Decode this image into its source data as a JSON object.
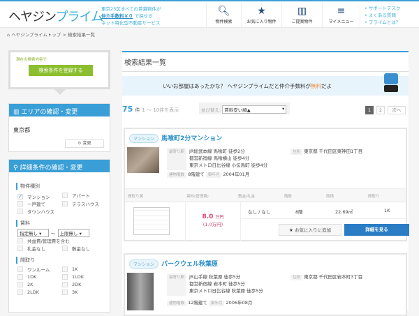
{
  "header": {
    "logo_a": "ヘヤジン",
    "logo_b": "プライム",
    "tagline1": "東京23区すべての賃貸物件が",
    "tagline2a": "仲介手数料￥０",
    "tagline2b": "で探せる",
    "tagline3": "ネット特化型不動産サービス",
    "nav": [
      {
        "icon": "search-icon",
        "glyph": "🔍︎",
        "label": "物件検索"
      },
      {
        "icon": "star-icon",
        "glyph": "★",
        "label": "お気に入り物件"
      },
      {
        "icon": "building-icon",
        "glyph": "▥",
        "label": "ご提案物件"
      },
      {
        "icon": "menu-icon",
        "glyph": "≡",
        "label": "マイメニュー"
      }
    ],
    "links": [
      "サポートデスク",
      "よくある質問",
      "プライムとは？"
    ]
  },
  "breadcrumb": {
    "home": "ヘヤジンプライムトップ",
    "sep": ">",
    "current": "検索結果一覧"
  },
  "sidebar": {
    "save_label": "現在の検索内容で",
    "save_button": "検索条件を登録する",
    "area_title": "エリアの確認・変更",
    "area_value": "東京都",
    "change_button": "変更",
    "detail_title": "詳細条件の確認・変更",
    "type_title": "物件種別",
    "types": [
      {
        "label": "マンション",
        "checked": true
      },
      {
        "label": "アパート",
        "checked": false
      },
      {
        "label": "一戸建て",
        "checked": false
      },
      {
        "label": "テラスハウス",
        "checked": false
      },
      {
        "label": "タウンハウス",
        "checked": false
      }
    ],
    "rent_title": "賃料",
    "rent_min": "指定無し",
    "rent_tilde": "～",
    "rent_max": "上限無し",
    "rent_opts": [
      "共益費/管理費を含む",
      "礼金なし",
      "敷金なし"
    ],
    "layout_title": "間取り",
    "layouts": [
      "ワンルーム",
      "1K",
      "1DK",
      "1LDK",
      "2K",
      "2DK",
      "2LDK",
      "3K"
    ]
  },
  "main": {
    "title": "検索結果一覧",
    "banner_a": "いいお部屋はあったかな？ ヘヤジンプライムだと仲介手数料が",
    "banner_b": "無料",
    "banner_c": "だよ",
    "count": "75",
    "count_unit": "件",
    "range": "1 ～ 10件を表示",
    "sort_label": "並び替え:",
    "sort_value": "賃料安い順▲",
    "pages": [
      "1",
      "2"
    ],
    "next": "次へ",
    "col_headers": [
      "間取り図",
      "賃料(管理費)",
      "敷金/礼金",
      "階数",
      "面積",
      "間取り"
    ],
    "fav_button": "お気に入りに追加",
    "detail_button": "詳細を見る",
    "labels": {
      "station": "最寄り駅",
      "address": "住所",
      "floors": "建物階数",
      "built": "築年月"
    },
    "listings": [
      {
        "type": "マンション",
        "name": "馬喰町2分マンション",
        "stations": [
          "JR総武本線 馬喰町 徒歩2分",
          "都営新宿線 馬喰横山 徒歩4分",
          "東京メトロ日比谷線 小伝馬町 徒歩4分"
        ],
        "address": "東京都 千代田区東神田1丁目",
        "floors": "8階建て",
        "built": "2004年01月",
        "rent": "8.0",
        "rent_unit": "万円",
        "fee": "(1.0万円)",
        "deposit": "なし / なし",
        "floor": "8階",
        "area": "22.69㎡",
        "layout": "1K"
      },
      {
        "type": "マンション",
        "name": "パークウェル秋葉原",
        "stations": [
          "JR山手線 秋葉原 徒歩5分",
          "都営新宿線 岩本町 徒歩5分",
          "東京メトロ日比谷線 秋葉原 徒歩5分"
        ],
        "address": "東京都 千代田区岩本町3丁目",
        "floors": "12階建て",
        "built": "2006年08月"
      }
    ]
  }
}
